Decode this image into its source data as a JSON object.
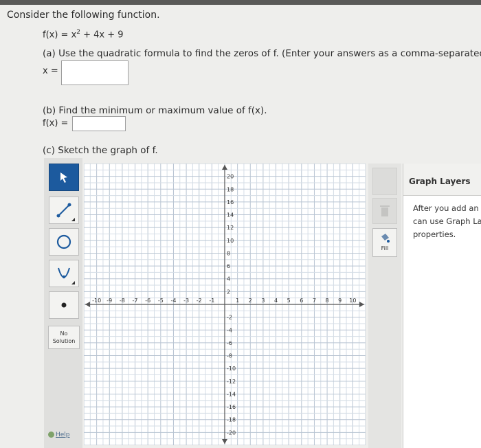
{
  "question": {
    "intro": "Consider the following function.",
    "function_lhs": "f(x) = x",
    "function_exp": "2",
    "function_rhs": " + 4x + 9",
    "part_a": "(a) Use the quadratic formula to find the zeros of f. (Enter your answers as a comma-separated list.",
    "part_a_label": "x =",
    "part_a_value": "",
    "part_b": "(b) Find the minimum or maximum value of f(x).",
    "part_b_label": "f(x) =",
    "part_b_value": "",
    "part_c": "(c) Sketch the graph of f."
  },
  "toolbar": {
    "tools": [
      {
        "name": "select",
        "icon": "pointer-arrow-icon"
      },
      {
        "name": "line",
        "icon": "line-icon"
      },
      {
        "name": "circle",
        "icon": "circle-icon"
      },
      {
        "name": "parabola",
        "icon": "parabola-icon"
      },
      {
        "name": "point",
        "icon": "point-icon"
      }
    ],
    "no_solution": "No Solution",
    "help": "Help"
  },
  "graph": {
    "x_ticks": [
      "-10",
      "-9",
      "-8",
      "-7",
      "-6",
      "-5",
      "-4",
      "-3",
      "-2",
      "-1",
      "1",
      "2",
      "3",
      "4",
      "5",
      "6",
      "7",
      "8",
      "9",
      "10"
    ],
    "y_ticks_pos": [
      "20",
      "18",
      "16",
      "14",
      "12",
      "10",
      "8",
      "6",
      "4",
      "2"
    ],
    "y_ticks_neg": [
      "-2",
      "-4",
      "-6",
      "-8",
      "-10",
      "-12",
      "-14",
      "-16",
      "-18",
      "-20"
    ],
    "xlim": [
      -11,
      11
    ],
    "ylim": [
      -22,
      22
    ]
  },
  "right_tools": {
    "fill_label": "Fill"
  },
  "layers": {
    "title": "Graph Layers",
    "desc_lines": [
      "After you add an o",
      "can use Graph La",
      "properties."
    ]
  }
}
